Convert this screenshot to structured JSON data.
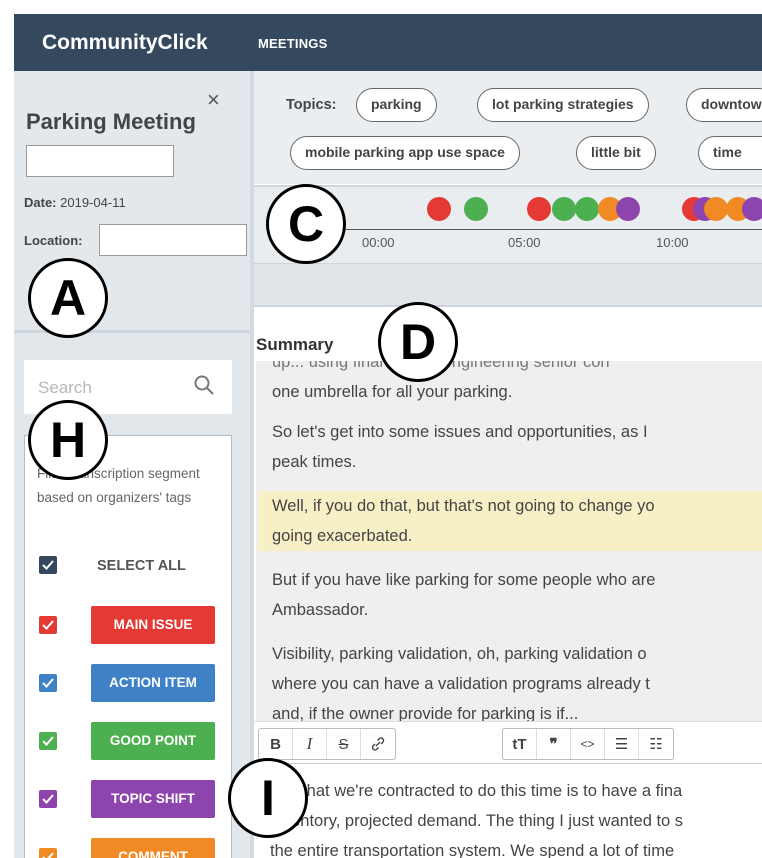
{
  "app": {
    "brand": "CommunityClick",
    "nav_meetings": "MEETINGS"
  },
  "meeting": {
    "title": "Parking Meeting",
    "date_label": "Date:",
    "date_value": "2019-04-11",
    "location_label": "Location:",
    "close_icon": "×"
  },
  "search": {
    "placeholder": "Search"
  },
  "filter": {
    "description": "Filter transcription segment based on organizers' tags",
    "select_all": "SELECT ALL",
    "tags": [
      {
        "label": "MAIN ISSUE",
        "color": "#e53935"
      },
      {
        "label": "ACTION ITEM",
        "color": "#3f81c6"
      },
      {
        "label": "GOOD POINT",
        "color": "#4caf50"
      },
      {
        "label": "TOPIC SHIFT",
        "color": "#8e44ad"
      },
      {
        "label": "COMMENT",
        "color": "#f08a24"
      }
    ]
  },
  "topics": {
    "label": "Topics:",
    "chips": [
      "parking",
      "lot parking strategies",
      "downtown",
      "mobile parking app use space",
      "little bit",
      "time"
    ]
  },
  "timeline": {
    "ticks": [
      "00:00",
      "05:00",
      "10:00"
    ],
    "dots": [
      {
        "color": "#e53935"
      },
      {
        "color": "#4caf50"
      },
      {
        "color": "#e53935"
      },
      {
        "color": "#4caf50"
      },
      {
        "color": "#4caf50"
      },
      {
        "color": "#f08a24"
      },
      {
        "color": "#8e44ad"
      },
      {
        "color": "#e53935"
      },
      {
        "color": "#8e44ad"
      },
      {
        "color": "#f08a24"
      },
      {
        "color": "#f08a24"
      },
      {
        "color": "#8e44ad"
      }
    ]
  },
  "summary": {
    "title": "Summary",
    "paragraphs": [
      {
        "lines": [
          "up... using finance and engineering senior con",
          "one umbrella for all your parking."
        ],
        "highlight": false
      },
      {
        "lines": [
          "So let's get into some issues and opportunities, as I",
          "peak times."
        ],
        "highlight": false
      },
      {
        "lines": [
          "Well, if you do that, but that's not going to change yo",
          "going exacerbated."
        ],
        "highlight": true
      },
      {
        "lines": [
          "But if you have like parking for some people who are",
          "Ambassador."
        ],
        "highlight": false
      },
      {
        "lines": [
          "Visibility, parking validation, oh, parking validation o",
          "where you can have a validation programs already t",
          "and, if the owner provide for parking is if..."
        ],
        "highlight": false
      }
    ]
  },
  "toolbar": {
    "bold": "B",
    "italic": "I",
    "strike": "S",
    "link": "link-icon",
    "heading": "tT",
    "quote": "❞",
    "code": "<>",
    "bullets": "☰",
    "numbers": "☷"
  },
  "editor": {
    "lines": [
      "So what we're contracted to do this time is to have a fina",
      "inventory, projected demand. The thing I just wanted to s",
      "the entire transportation system. We spend a lot of time"
    ]
  },
  "callouts": {
    "a": "A",
    "c": "C",
    "d": "D",
    "h": "H",
    "i": "I"
  }
}
